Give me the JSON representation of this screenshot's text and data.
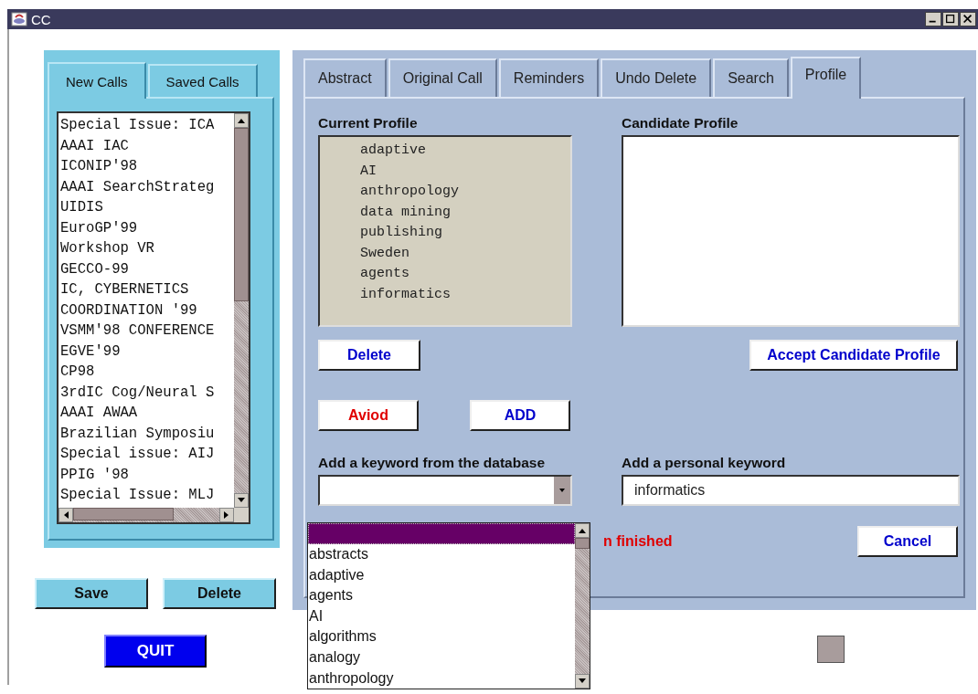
{
  "window": {
    "title": "CC"
  },
  "calls_panel": {
    "tabs": [
      {
        "label": "New Calls",
        "selected": true
      },
      {
        "label": "Saved Calls",
        "selected": false
      }
    ],
    "calls": [
      "Special Issue: ICA",
      "AAAI IAC",
      "ICONIP'98",
      "AAAI SearchStrateg",
      "UIDIS",
      "EuroGP'99",
      "Workshop VR",
      "GECCO-99",
      "IC, CYBERNETICS",
      "COORDINATION '99",
      "VSMM'98 CONFERENCE",
      "EGVE'99",
      "CP98",
      "3rdIC Cog/Neural S",
      "AAAI AWAA",
      "Brazilian Symposiu",
      "Special issue: AIJ",
      "PPIG '98",
      "Special Issue: MLJ"
    ],
    "buttons": [
      "Save",
      "Delete"
    ]
  },
  "quit_button": "QUIT",
  "main_tabs": [
    {
      "label": "Abstract",
      "selected": false
    },
    {
      "label": "Original Call",
      "selected": false
    },
    {
      "label": "Reminders",
      "selected": false
    },
    {
      "label": "Undo Delete",
      "selected": false
    },
    {
      "label": "Search",
      "selected": false
    },
    {
      "label": "Profile",
      "selected": true
    }
  ],
  "profile": {
    "current_label": "Current Profile",
    "current_items": [
      "adaptive",
      "AI",
      "anthropology",
      "data mining",
      "publishing",
      "Sweden",
      "agents",
      "informatics"
    ],
    "candidate_label": "Candidate Profile",
    "delete_button": "Delete",
    "accept_button": "Accept Candidate Profile",
    "keyword_buttons": [
      {
        "label": "Aviod",
        "color": "#e00000"
      },
      {
        "label": "ADD",
        "color": "#0000cc"
      }
    ],
    "database_label": "Add a keyword from the database",
    "personal_label": "Add a personal keyword",
    "personal_keyword": "informatics",
    "status_text": "n finished",
    "cancel_button": "Cancel",
    "dropdown": {
      "blank_option_selected": true,
      "options": [
        "abstracts",
        "adaptive",
        "agents",
        "AI",
        "algorithms",
        "analogy",
        "anthropology"
      ]
    }
  }
}
